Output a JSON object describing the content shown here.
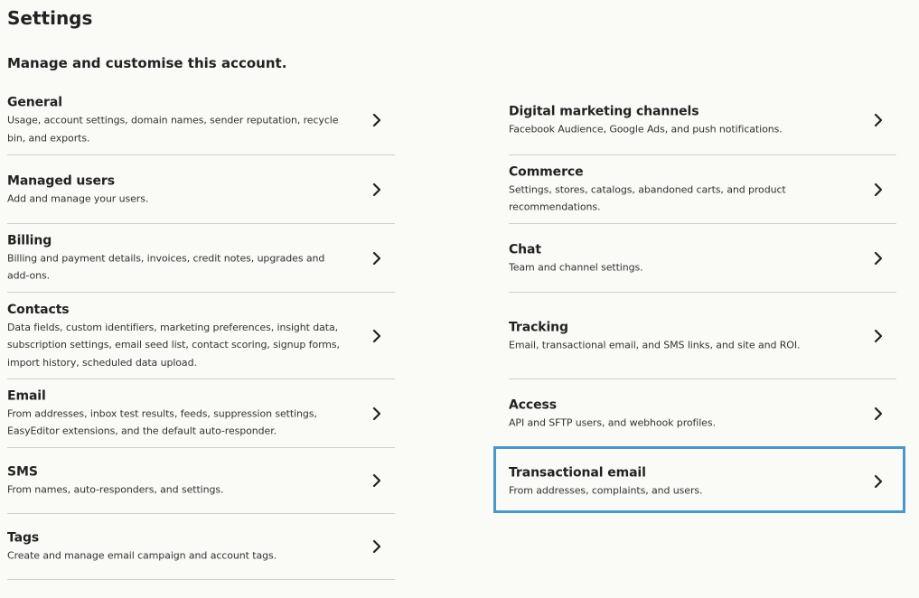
{
  "page": {
    "title": "Settings",
    "subtitle": "Manage and customise this account."
  },
  "left_items": [
    {
      "title": "General",
      "desc": "Usage, account settings, domain names, sender reputation, recycle bin, and exports."
    },
    {
      "title": "Managed users",
      "desc": "Add and manage your users."
    },
    {
      "title": "Billing",
      "desc": "Billing and payment details, invoices, credit notes, upgrades and add-ons."
    },
    {
      "title": "Contacts",
      "desc": "Data fields, custom identifiers, marketing preferences, insight data, subscription settings, email seed list, contact scoring, signup forms, import history, scheduled data upload."
    },
    {
      "title": "Email",
      "desc": "From addresses, inbox test results, feeds, suppression settings, EasyEditor extensions, and the default auto-responder."
    },
    {
      "title": "SMS",
      "desc": "From names, auto-responders, and settings."
    },
    {
      "title": "Tags",
      "desc": "Create and manage email campaign and account tags."
    }
  ],
  "right_items": [
    {
      "title": "Digital marketing channels",
      "desc": "Facebook Audience, Google Ads, and push notifications."
    },
    {
      "title": "Commerce",
      "desc": "Settings, stores, catalogs, abandoned carts, and product recommendations."
    },
    {
      "title": "Chat",
      "desc": "Team and channel settings."
    },
    {
      "title": "Tracking",
      "desc": "Email, transactional email, and SMS links, and site and ROI."
    },
    {
      "title": "Access",
      "desc": "API and SFTP users, and webhook profiles."
    },
    {
      "title": "Transactional email",
      "desc": "From addresses, complaints, and users."
    }
  ],
  "colors": {
    "background": "#fafaf7",
    "divider": "#cfcfcb",
    "highlight": "#4a97c8"
  },
  "icons": {
    "row_chevron": "chevron-right-icon"
  }
}
